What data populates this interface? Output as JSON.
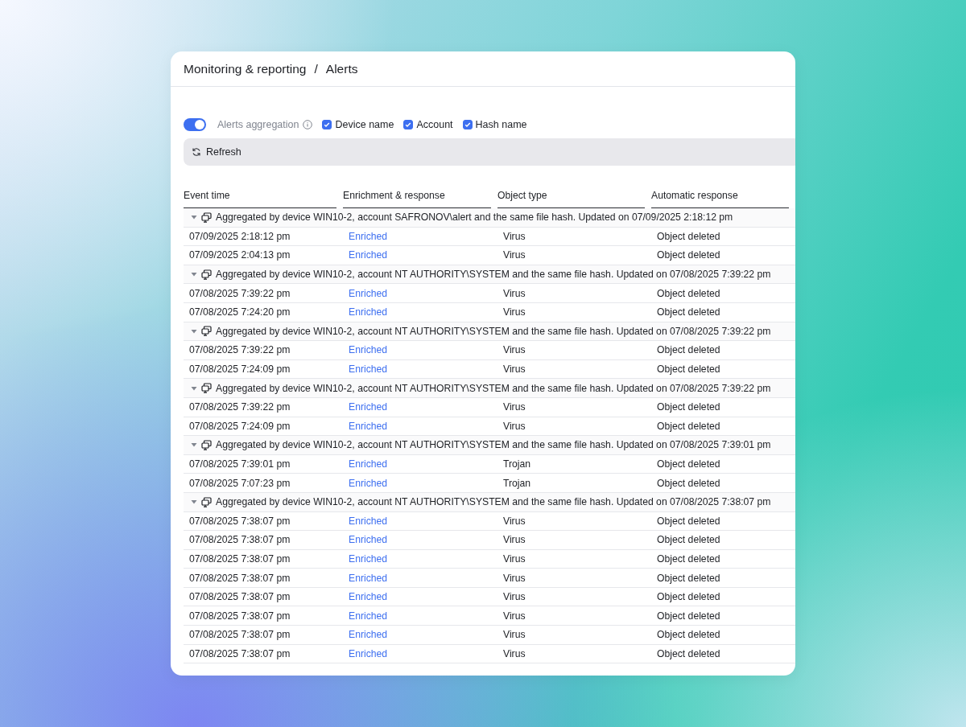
{
  "breadcrumb": {
    "parent": "Monitoring & reporting",
    "separator": "/",
    "current": "Alerts"
  },
  "aggregation": {
    "label": "Alerts aggregation",
    "on": true
  },
  "filters": [
    {
      "label": "Device name",
      "checked": true
    },
    {
      "label": "Account",
      "checked": true
    },
    {
      "label": "Hash name",
      "checked": true
    }
  ],
  "refresh_button": {
    "label": "Refresh"
  },
  "table": {
    "columns": [
      "Event time",
      "Enrichment & response",
      "Object type",
      "Automatic response"
    ],
    "groups": [
      {
        "label": "Aggregated by device WIN10-2, account SAFRONOV\\alert and the same file hash. Updated on 07/09/2025 2:18:12 pm",
        "expanded": true,
        "rows": [
          [
            "07/09/2025 2:18:12 pm",
            "Enriched",
            "Virus",
            "Object deleted"
          ],
          [
            "07/09/2025 2:04:13 pm",
            "Enriched",
            "Virus",
            "Object deleted"
          ]
        ]
      },
      {
        "label": "Aggregated by device WIN10-2, account NT AUTHORITY\\SYSTEM and the same file hash. Updated on 07/08/2025 7:39:22 pm",
        "expanded": true,
        "rows": [
          [
            "07/08/2025 7:39:22 pm",
            "Enriched",
            "Virus",
            "Object deleted"
          ],
          [
            "07/08/2025 7:24:20 pm",
            "Enriched",
            "Virus",
            "Object deleted"
          ]
        ]
      },
      {
        "label": "Aggregated by device WIN10-2, account NT AUTHORITY\\SYSTEM and the same file hash. Updated on 07/08/2025 7:39:22 pm",
        "expanded": true,
        "rows": [
          [
            "07/08/2025 7:39:22 pm",
            "Enriched",
            "Virus",
            "Object deleted"
          ],
          [
            "07/08/2025 7:24:09 pm",
            "Enriched",
            "Virus",
            "Object deleted"
          ]
        ]
      },
      {
        "label": "Aggregated by device WIN10-2, account NT AUTHORITY\\SYSTEM and the same file hash. Updated on 07/08/2025 7:39:22 pm",
        "expanded": true,
        "rows": [
          [
            "07/08/2025 7:39:22 pm",
            "Enriched",
            "Virus",
            "Object deleted"
          ],
          [
            "07/08/2025 7:24:09 pm",
            "Enriched",
            "Virus",
            "Object deleted"
          ]
        ]
      },
      {
        "label": "Aggregated by device WIN10-2, account NT AUTHORITY\\SYSTEM and the same file hash. Updated on 07/08/2025 7:39:01 pm",
        "expanded": true,
        "rows": [
          [
            "07/08/2025 7:39:01 pm",
            "Enriched",
            "Trojan",
            "Object deleted"
          ],
          [
            "07/08/2025 7:07:23 pm",
            "Enriched",
            "Trojan",
            "Object deleted"
          ]
        ]
      },
      {
        "label": "Aggregated by device WIN10-2, account NT AUTHORITY\\SYSTEM and the same file hash. Updated on 07/08/2025 7:38:07 pm",
        "expanded": true,
        "rows": [
          [
            "07/08/2025 7:38:07 pm",
            "Enriched",
            "Virus",
            "Object deleted"
          ],
          [
            "07/08/2025 7:38:07 pm",
            "Enriched",
            "Virus",
            "Object deleted"
          ],
          [
            "07/08/2025 7:38:07 pm",
            "Enriched",
            "Virus",
            "Object deleted"
          ],
          [
            "07/08/2025 7:38:07 pm",
            "Enriched",
            "Virus",
            "Object deleted"
          ],
          [
            "07/08/2025 7:38:07 pm",
            "Enriched",
            "Virus",
            "Object deleted"
          ],
          [
            "07/08/2025 7:38:07 pm",
            "Enriched",
            "Virus",
            "Object deleted"
          ],
          [
            "07/08/2025 7:38:07 pm",
            "Enriched",
            "Virus",
            "Object deleted"
          ],
          [
            "07/08/2025 7:38:07 pm",
            "Enriched",
            "Virus",
            "Object deleted"
          ]
        ]
      }
    ]
  }
}
